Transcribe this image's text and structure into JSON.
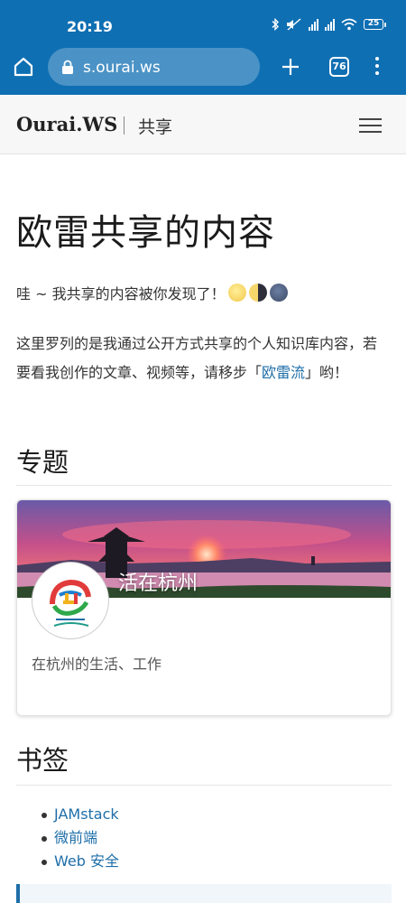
{
  "status_bar": {
    "time": "20:19",
    "battery": "25",
    "icons": [
      "bluetooth-icon",
      "mute-icon",
      "signal-icon",
      "signal-icon",
      "wifi-icon",
      "battery-icon"
    ]
  },
  "browser": {
    "url": "s.ourai.ws",
    "tab_count": "76",
    "accent_color": "#0f6fb3"
  },
  "site_header": {
    "brand": "Ourai.WS",
    "section": "共享"
  },
  "page": {
    "title": "欧雷共享的内容",
    "intro": "哇 ~ 我共享的内容被你发现了！",
    "para_before_link": "这里罗列的是我通过公开方式共享的个人知识库内容，若要看我创作的文章、视频等，请移步「",
    "para_link": "欧雷流",
    "para_after_link": "」哟！"
  },
  "topics": {
    "heading": "专题",
    "card": {
      "title": "活在杭州",
      "description": "在杭州的生活、工作"
    }
  },
  "bookmarks": {
    "heading": "书签",
    "items": [
      "JAMstack",
      "微前端",
      "Web 安全"
    ]
  }
}
